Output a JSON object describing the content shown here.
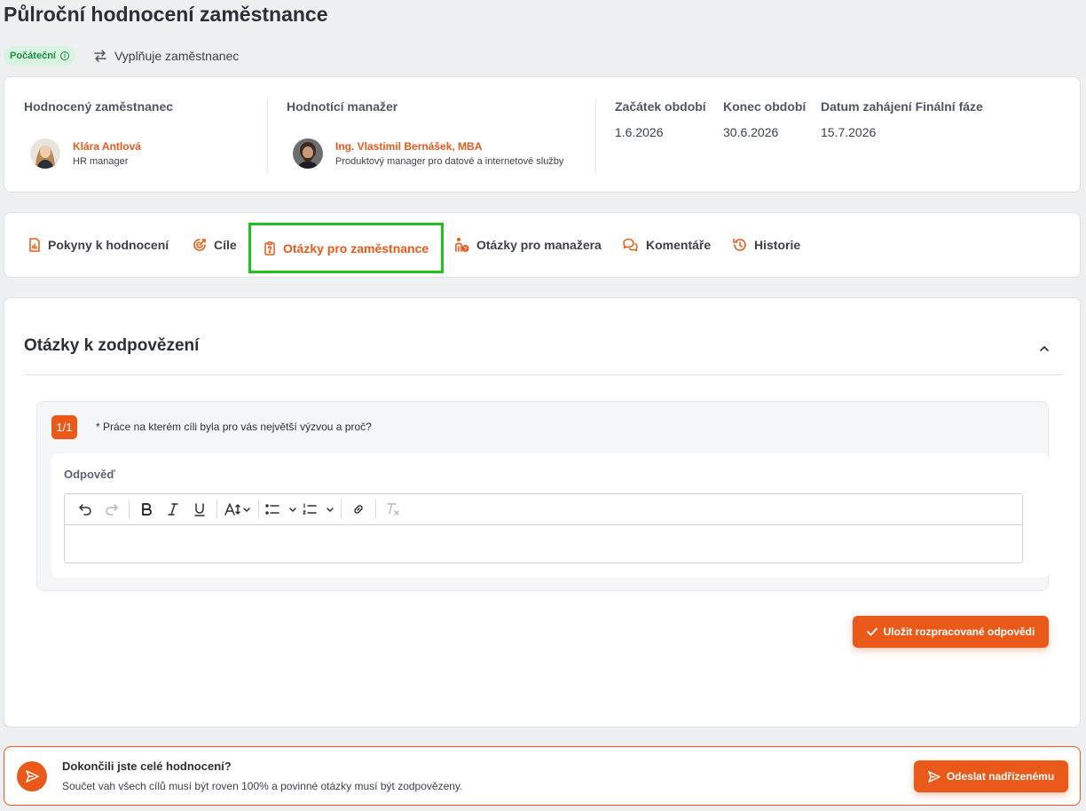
{
  "page": {
    "title": "Půlroční hodnocení zaměstnance"
  },
  "status": {
    "badge": "Počáteční",
    "filler": "Vyplňuje zaměstnanec"
  },
  "info": {
    "employee": {
      "label": "Hodnocený zaměstnanec",
      "name": "Klára Antlová",
      "role": "HR manager"
    },
    "manager": {
      "label": "Hodnotící manažer",
      "name": "Ing. Vlastimil Bernášek, MBA",
      "role": "Produktový manager pro datové a internetové služby"
    },
    "dates": [
      {
        "label": "Začátek období",
        "value": "1.6.2026"
      },
      {
        "label": "Konec období",
        "value": "30.6.2026"
      },
      {
        "label": "Datum zahájení Finální fáze",
        "value": "15.7.2026"
      }
    ]
  },
  "tabs": [
    {
      "label": "Pokyny k hodnocení",
      "icon": "document-chart-icon"
    },
    {
      "label": "Cíle",
      "icon": "target-icon"
    },
    {
      "label": "Otázky pro zaměstnance",
      "icon": "clipboard-question-icon",
      "active": true
    },
    {
      "label": "Otázky pro manažera",
      "icon": "person-question-icon"
    },
    {
      "label": "Komentáře",
      "icon": "chat-bubbles-icon"
    },
    {
      "label": "Historie",
      "icon": "history-icon"
    }
  ],
  "section": {
    "title": "Otázky k zodpovězení",
    "question": {
      "number": "1/1",
      "text": "* Práce na kterém cíli byla pro vás největší výzvou a proč?"
    },
    "answer_label": "Odpověď",
    "answer_value": "",
    "save_button": "Uložit rozpracované odpovědi"
  },
  "footer": {
    "title": "Dokončili jste celé hodnocení?",
    "subtitle": "Součet vah všech cílů musí být roven 100% a povinné otázky musí být zodpovězeny.",
    "send_button": "Odeslat nadřízenému"
  },
  "colors": {
    "accent": "#e8591a",
    "highlight": "#21c021",
    "badge_bg": "#d7f5e0",
    "badge_text": "#1e8a46"
  }
}
